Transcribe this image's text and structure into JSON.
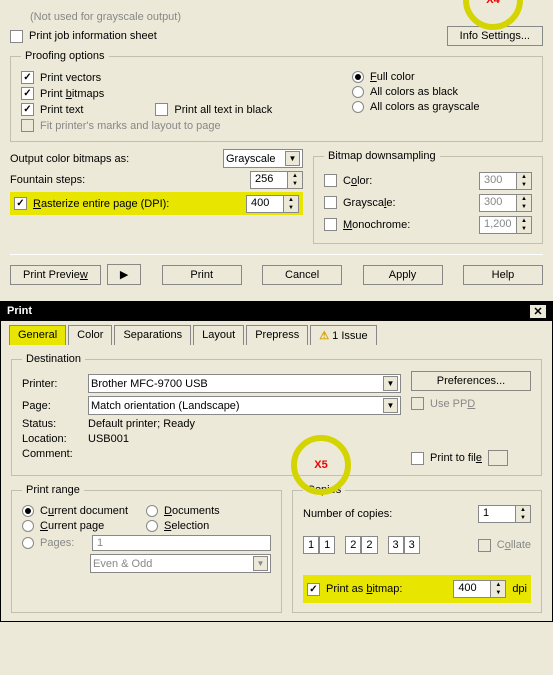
{
  "upper": {
    "grayscale_note": "(Not used for grayscale output)",
    "job_sheet": "Print job information sheet",
    "info_settings": "Info Settings...",
    "proofing": {
      "legend": "Proofing options",
      "vectors": "Print vectors",
      "bitmaps": "Print bitmaps",
      "text": "Print text",
      "all_black": "Print all text in black",
      "printers_marks": "Fit printer's marks and layout to page",
      "full_color": "Full color",
      "all_black_colors": "All colors as black",
      "all_gray": "All colors as grayscale"
    },
    "output_as": "Output color bitmaps as:",
    "output_val": "Grayscale",
    "fountain": "Fountain steps:",
    "fountain_val": "256",
    "rasterize": "Rasterize entire page (DPI):",
    "rasterize_val": "400",
    "downsample": {
      "legend": "Bitmap downsampling",
      "color": "Color:",
      "color_val": "300",
      "gray": "Grayscale:",
      "gray_val": "300",
      "mono": "Monochrome:",
      "mono_val": "1,200"
    },
    "buttons": {
      "preview": "Print Preview",
      "print": "Print",
      "cancel": "Cancel",
      "apply": "Apply",
      "help": "Help"
    }
  },
  "lower": {
    "title": "Print",
    "tabs": {
      "general": "General",
      "color": "Color",
      "sep": "Separations",
      "layout": "Layout",
      "prepress": "Prepress",
      "issue": "1 Issue"
    },
    "dest": {
      "legend": "Destination",
      "printer": "Printer:",
      "printer_val": "Brother MFC-9700 USB",
      "page": "Page:",
      "page_val": "Match orientation (Landscape)",
      "status": "Status:",
      "status_val": "Default printer; Ready",
      "location": "Location:",
      "location_val": "USB001",
      "comment": "Comment:",
      "prefs": "Preferences...",
      "use_ppd": "Use PPD",
      "print_file": "Print to file"
    },
    "range": {
      "legend": "Print range",
      "cur_doc": "Current document",
      "docs": "Documents",
      "cur_page": "Current page",
      "sel": "Selection",
      "pages": "Pages:",
      "pages_val": "1",
      "even_odd": "Even & Odd"
    },
    "copies": {
      "legend": "Copies",
      "num": "Number of copies:",
      "num_val": "1",
      "collate": "Collate",
      "as_bitmap": "Print as bitmap:",
      "dpi_val": "400",
      "dpi_unit": "dpi"
    }
  },
  "annotations": {
    "x4": "X4",
    "x5": "X5"
  }
}
